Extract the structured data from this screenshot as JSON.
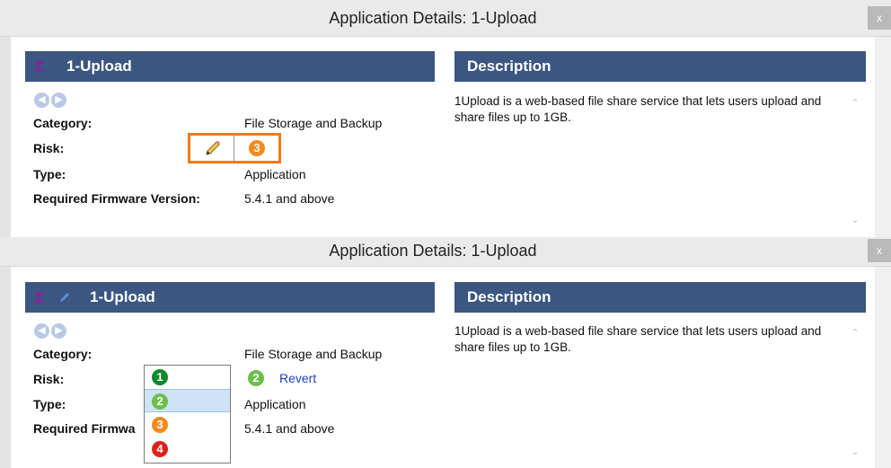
{
  "colors": {
    "header_bg": "#3b5681",
    "risk1": "#0f8a2c",
    "risk2": "#6cc04a",
    "risk3": "#f28b1c",
    "risk4": "#e0201c",
    "highlight_border": "#f07a1a",
    "link": "#1f3fbf"
  },
  "panel1": {
    "title": "Application Details: 1-Upload",
    "close_label": "x",
    "app_name": "1-Upload",
    "description_header": "Description",
    "description_text": "1Upload is a web-based file share service that lets users upload and share files up to 1GB.",
    "rows": {
      "category_label": "Category:",
      "category_value": "File Storage and Backup",
      "risk_label": "Risk:",
      "risk_value": "3",
      "type_label": "Type:",
      "type_value": "Application",
      "firmware_label": "Required Firmware Version:",
      "firmware_value": "5.4.1 and above"
    }
  },
  "panel2": {
    "title": "Application Details: 1-Upload",
    "close_label": "x",
    "app_name": "1-Upload",
    "description_header": "Description",
    "description_text": "1Upload is a web-based file share service that lets users upload and share files up to 1GB.",
    "rows": {
      "category_label": "Category:",
      "category_value": "File Storage and Backup",
      "risk_label": "Risk:",
      "current_risk": "2",
      "revert_label": "Revert",
      "type_label": "Type:",
      "type_value": "Application",
      "firmware_label": "Required Firmwa",
      "firmware_value": "5.4.1 and above"
    },
    "risk_options": [
      "1",
      "2",
      "3",
      "4"
    ],
    "selected_option": "2"
  }
}
